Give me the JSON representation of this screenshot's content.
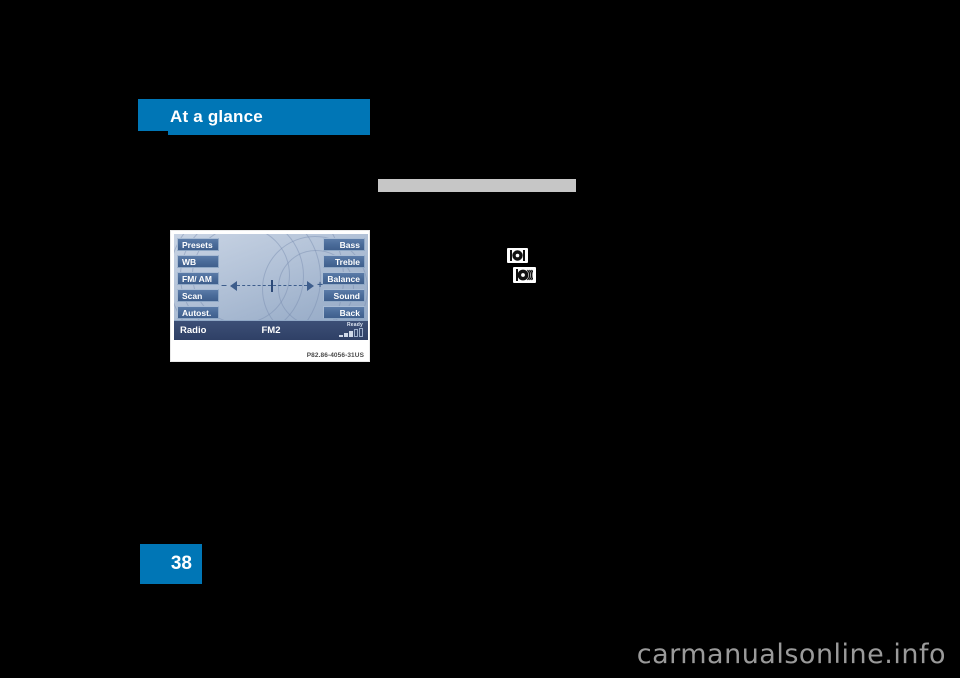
{
  "page": {
    "background_color": "#000000",
    "accent_color": "#0076b6",
    "number": "38"
  },
  "chapter_header": {
    "title": "At a glance"
  },
  "right_column": {
    "heading_bar_color": "#c6c6c6"
  },
  "figure": {
    "caption": "P82.86-4056-31US",
    "display": {
      "left_buttons": [
        {
          "label": "Presets"
        },
        {
          "label": "WB"
        },
        {
          "label": "FM/ AM"
        },
        {
          "label": "Scan"
        },
        {
          "label": "Autost."
        }
      ],
      "right_buttons": [
        {
          "label": "Bass"
        },
        {
          "label": "Treble"
        },
        {
          "label": "Balance"
        },
        {
          "label": "Sound"
        },
        {
          "label": "Back"
        }
      ],
      "slider": {
        "minus_label": "–",
        "plus_label": "+",
        "position_percent": 50
      },
      "status_bar": {
        "source": "Radio",
        "band": "FM2",
        "signal_label": "Ready",
        "signal_bars_filled": 3,
        "signal_bars_total": 5
      }
    }
  },
  "inline_icons": [
    {
      "name": "knob-press-icon",
      "title": "control knob press"
    },
    {
      "name": "knob-turn-icon",
      "title": "control knob turn"
    }
  ],
  "watermark": {
    "text": "carmanualsonline.info"
  }
}
